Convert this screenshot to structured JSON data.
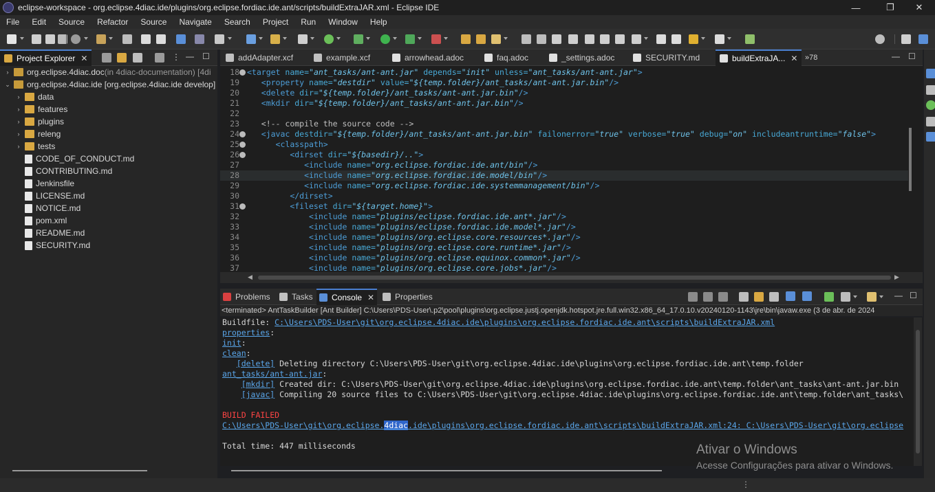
{
  "window": {
    "title": "eclipse-workspace - org.eclipse.4diac.ide/plugins/org.eclipse.fordiac.ide.ant/scripts/buildExtraJAR.xml - Eclipse IDE",
    "minimize": "—",
    "maximize": "❐",
    "close": "✕"
  },
  "menu": [
    "File",
    "Edit",
    "Source",
    "Refactor",
    "Source",
    "Navigate",
    "Search",
    "Project",
    "Run",
    "Window",
    "Help"
  ],
  "explorer": {
    "tab_label": "Project Explorer",
    "items": [
      {
        "label": "org.eclipse.4diac.doc",
        "suffix": " (in 4diac-documentation) [4di",
        "type": "project",
        "arrow": "›"
      },
      {
        "label": "org.eclipse.4diac.ide [org.eclipse.4diac.ide develop]",
        "suffix": "",
        "type": "project",
        "arrow": "⌄"
      },
      {
        "label": "data",
        "type": "folder",
        "arrow": "›"
      },
      {
        "label": "features",
        "type": "folder",
        "arrow": "›"
      },
      {
        "label": "plugins",
        "type": "folder",
        "arrow": "›"
      },
      {
        "label": "releng",
        "type": "folder",
        "arrow": "›"
      },
      {
        "label": "tests",
        "type": "folder",
        "arrow": "›"
      },
      {
        "label": "CODE_OF_CONDUCT.md",
        "type": "file"
      },
      {
        "label": "CONTRIBUTING.md",
        "type": "file"
      },
      {
        "label": "Jenkinsfile",
        "type": "file"
      },
      {
        "label": "LICENSE.md",
        "type": "file"
      },
      {
        "label": "NOTICE.md",
        "type": "file"
      },
      {
        "label": "pom.xml",
        "type": "file"
      },
      {
        "label": "README.md",
        "type": "file"
      },
      {
        "label": "SECURITY.md",
        "type": "file"
      }
    ]
  },
  "editor_tabs": [
    {
      "label": "addAdapter.xcf"
    },
    {
      "label": "example.xcf"
    },
    {
      "label": "arrowhead.adoc"
    },
    {
      "label": "faq.adoc"
    },
    {
      "label": "_settings.adoc"
    },
    {
      "label": "SECURITY.md"
    },
    {
      "label": "buildExtraJA...",
      "active": true
    }
  ],
  "editor_overflow": "»78",
  "code": [
    {
      "n": "18",
      "fold": true,
      "indent": "",
      "parts": [
        [
          "tag",
          "<target "
        ],
        [
          "attr",
          "name="
        ],
        [
          "val",
          "\"ant_tasks/ant-ant.jar\""
        ],
        [
          "attr",
          " depends="
        ],
        [
          "val",
          "\"init\""
        ],
        [
          "attr",
          " unless="
        ],
        [
          "val",
          "\"ant_tasks/ant-ant.jar\""
        ],
        [
          "tag",
          ">"
        ]
      ]
    },
    {
      "n": "19",
      "indent": "   ",
      "parts": [
        [
          "tag",
          "<property "
        ],
        [
          "attr",
          "name="
        ],
        [
          "val",
          "\"destdir\""
        ],
        [
          "attr",
          " value="
        ],
        [
          "val",
          "\"${temp.folder}/ant_tasks/ant-ant.jar.bin\""
        ],
        [
          "tag",
          "/>"
        ]
      ]
    },
    {
      "n": "20",
      "indent": "   ",
      "parts": [
        [
          "tag",
          "<delete "
        ],
        [
          "attr",
          "dir="
        ],
        [
          "val",
          "\"${temp.folder}/ant_tasks/ant-ant.jar.bin\""
        ],
        [
          "tag",
          "/>"
        ]
      ]
    },
    {
      "n": "21",
      "indent": "   ",
      "parts": [
        [
          "tag",
          "<mkdir "
        ],
        [
          "attr",
          "dir="
        ],
        [
          "val",
          "\"${temp.folder}/ant_tasks/ant-ant.jar.bin\""
        ],
        [
          "tag",
          "/>"
        ]
      ]
    },
    {
      "n": "22",
      "indent": "",
      "parts": []
    },
    {
      "n": "23",
      "indent": "   ",
      "parts": [
        [
          "cmt",
          "<!-- compile the source code -->"
        ]
      ]
    },
    {
      "n": "24",
      "fold": true,
      "indent": "   ",
      "parts": [
        [
          "tag",
          "<javac "
        ],
        [
          "attr",
          "destdir="
        ],
        [
          "val",
          "\"${temp.folder}/ant_tasks/ant-ant.jar.bin\""
        ],
        [
          "attr",
          " failonerror="
        ],
        [
          "val",
          "\"true\""
        ],
        [
          "attr",
          " verbose="
        ],
        [
          "val",
          "\"true\""
        ],
        [
          "attr",
          " debug="
        ],
        [
          "val",
          "\"on\""
        ],
        [
          "attr",
          " includeantruntime="
        ],
        [
          "val",
          "\"false\""
        ],
        [
          "tag",
          ">"
        ]
      ]
    },
    {
      "n": "25",
      "fold": true,
      "indent": "      ",
      "parts": [
        [
          "tag",
          "<classpath>"
        ]
      ]
    },
    {
      "n": "26",
      "fold": true,
      "indent": "         ",
      "parts": [
        [
          "tag",
          "<dirset "
        ],
        [
          "attr",
          "dir="
        ],
        [
          "val",
          "\"${basedir}/..\""
        ],
        [
          "tag",
          ">"
        ]
      ]
    },
    {
      "n": "27",
      "indent": "            ",
      "parts": [
        [
          "tag",
          "<include "
        ],
        [
          "attr",
          "name="
        ],
        [
          "val",
          "\"org.eclipse.fordiac.ide.ant/bin\""
        ],
        [
          "tag",
          "/>"
        ]
      ]
    },
    {
      "n": "28",
      "indent": "            ",
      "highlight": true,
      "parts": [
        [
          "tag",
          "<include "
        ],
        [
          "attr",
          "name="
        ],
        [
          "val",
          "\"org.eclipse.fordiac.ide.model/bin\""
        ],
        [
          "tag",
          "/>"
        ]
      ]
    },
    {
      "n": "29",
      "indent": "            ",
      "parts": [
        [
          "tag",
          "<include "
        ],
        [
          "attr",
          "name="
        ],
        [
          "val",
          "\"org.eclipse.fordiac.ide.systemmanagement/bin\""
        ],
        [
          "tag",
          "/>"
        ]
      ]
    },
    {
      "n": "30",
      "indent": "         ",
      "parts": [
        [
          "tag",
          "</dirset>"
        ]
      ]
    },
    {
      "n": "31",
      "fold": true,
      "indent": "         ",
      "parts": [
        [
          "tag",
          "<fileset "
        ],
        [
          "attr",
          "dir="
        ],
        [
          "val",
          "\"${target.home}\""
        ],
        [
          "tag",
          ">"
        ]
      ]
    },
    {
      "n": "32",
      "indent": "             ",
      "parts": [
        [
          "tag",
          "<include "
        ],
        [
          "attr",
          "name="
        ],
        [
          "val",
          "\"plugins/eclipse.fordiac.ide.ant*.jar\""
        ],
        [
          "tag",
          "/>"
        ]
      ]
    },
    {
      "n": "33",
      "indent": "             ",
      "parts": [
        [
          "tag",
          "<include "
        ],
        [
          "attr",
          "name="
        ],
        [
          "val",
          "\"plugins/eclipse.fordiac.ide.model*.jar\""
        ],
        [
          "tag",
          "/>"
        ]
      ]
    },
    {
      "n": "34",
      "indent": "             ",
      "parts": [
        [
          "tag",
          "<include "
        ],
        [
          "attr",
          "name="
        ],
        [
          "val",
          "\"plugins/org.eclipse.core.resources*.jar\""
        ],
        [
          "tag",
          "/>"
        ]
      ]
    },
    {
      "n": "35",
      "indent": "             ",
      "parts": [
        [
          "tag",
          "<include "
        ],
        [
          "attr",
          "name="
        ],
        [
          "val",
          "\"plugins/org.eclipse.core.runtime*.jar\""
        ],
        [
          "tag",
          "/>"
        ]
      ]
    },
    {
      "n": "36",
      "indent": "             ",
      "parts": [
        [
          "tag",
          "<include "
        ],
        [
          "attr",
          "name="
        ],
        [
          "val",
          "\"plugins/org.eclipse.equinox.common*.jar\""
        ],
        [
          "tag",
          "/>"
        ]
      ]
    },
    {
      "n": "37",
      "indent": "             ",
      "parts": [
        [
          "tag",
          "<include "
        ],
        [
          "attr",
          "name="
        ],
        [
          "val",
          "\"plugins/org.eclipse.core.jobs*.jar\""
        ],
        [
          "tag",
          "/>"
        ]
      ]
    }
  ],
  "bottom_tabs": [
    {
      "label": "Problems"
    },
    {
      "label": "Tasks"
    },
    {
      "label": "Console",
      "active": true
    },
    {
      "label": "Properties"
    }
  ],
  "console": {
    "header": "<terminated> AntTaskBuilder [Ant Builder] C:\\Users\\PDS-User\\.p2\\pool\\plugins\\org.eclipse.justj.openjdk.hotspot.jre.full.win32.x86_64_17.0.10.v20240120-1143\\jre\\bin\\javaw.exe  (3 de abr. de 2024",
    "buildfile_label": "Buildfile: ",
    "buildfile_path": "C:\\Users\\PDS-User\\git\\org.eclipse.4diac.ide\\plugins\\org.eclipse.fordiac.ide.ant\\scripts\\buildExtraJAR.xml",
    "properties": "properties",
    "init": "init",
    "clean": "clean",
    "delete_tag": "[delete]",
    "delete_text": " Deleting directory C:\\Users\\PDS-User\\git\\org.eclipse.4diac.ide\\plugins\\org.eclipse.fordiac.ide.ant\\temp.folder",
    "ant_target": "ant_tasks/ant-ant.jar",
    "mkdir_tag": "[mkdir]",
    "mkdir_text": " Created dir: C:\\Users\\PDS-User\\git\\org.eclipse.4diac.ide\\plugins\\org.eclipse.fordiac.ide.ant\\temp.folder\\ant_tasks\\ant-ant.jar.bin",
    "javac_tag": "[javac]",
    "javac_text": " Compiling 20 source files to C:\\Users\\PDS-User\\git\\org.eclipse.4diac.ide\\plugins\\org.eclipse.fordiac.ide.ant\\temp.folder\\ant_tasks\\",
    "build_failed": "BUILD FAILED",
    "err_prefix": "C:\\Users\\PDS-User\\git\\org.eclipse.",
    "err_selected": "4diac",
    "err_suffix": ".ide\\plugins\\org.eclipse.fordiac.ide.ant\\scripts\\buildExtraJAR.xml:24: C:\\Users\\PDS-User\\git\\org.eclipse",
    "total_time": "Total time: 447 milliseconds"
  },
  "watermark": {
    "line1": "Ativar o Windows",
    "line2": "Acesse Configurações para ativar o Windows."
  },
  "colors": {
    "accent": "#4a7fd1",
    "tag": "#4d9ed8",
    "value": "#6fc3ea",
    "error": "#ff4444"
  }
}
